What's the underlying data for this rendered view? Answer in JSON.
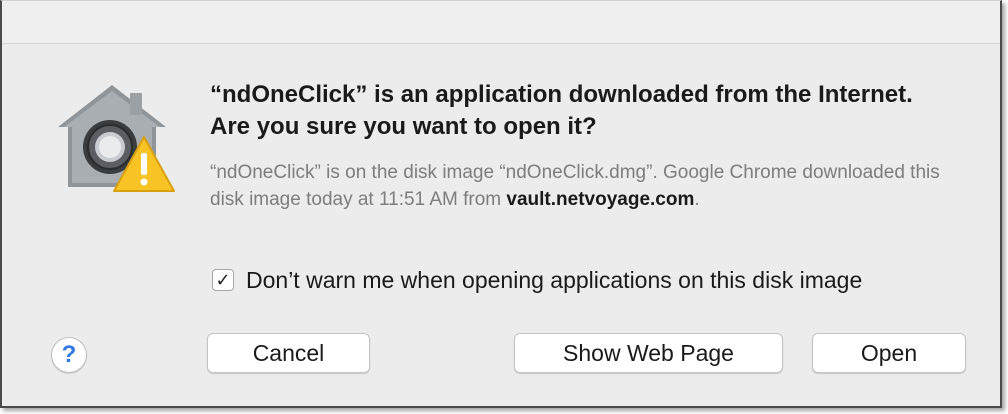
{
  "dialog": {
    "headline": "“ndOneClick” is an application downloaded from the Internet. Are you sure you want to open it?",
    "info_prefix": "“ndOneClick” is on the disk image “ndOneClick.dmg”. Google Chrome downloaded this disk image today at 11:51 AM from ",
    "info_domain": "vault.netvoyage.com",
    "info_suffix": ".",
    "checkbox": {
      "checked": true,
      "mark": "✓",
      "label": "Don’t warn me when opening applications on this disk image"
    },
    "help_label": "?",
    "buttons": {
      "cancel": "Cancel",
      "show_web_page": "Show Web Page",
      "open": "Open"
    }
  },
  "icons": {
    "app_icon": "gatekeeper-house-lock-warning-icon",
    "help_icon": "question-mark-icon"
  },
  "colors": {
    "dialog_bg": "#ececec",
    "warning_yellow": "#f7c325",
    "help_blue": "#2f7ae5",
    "secondary_text": "#7d7d7d"
  }
}
